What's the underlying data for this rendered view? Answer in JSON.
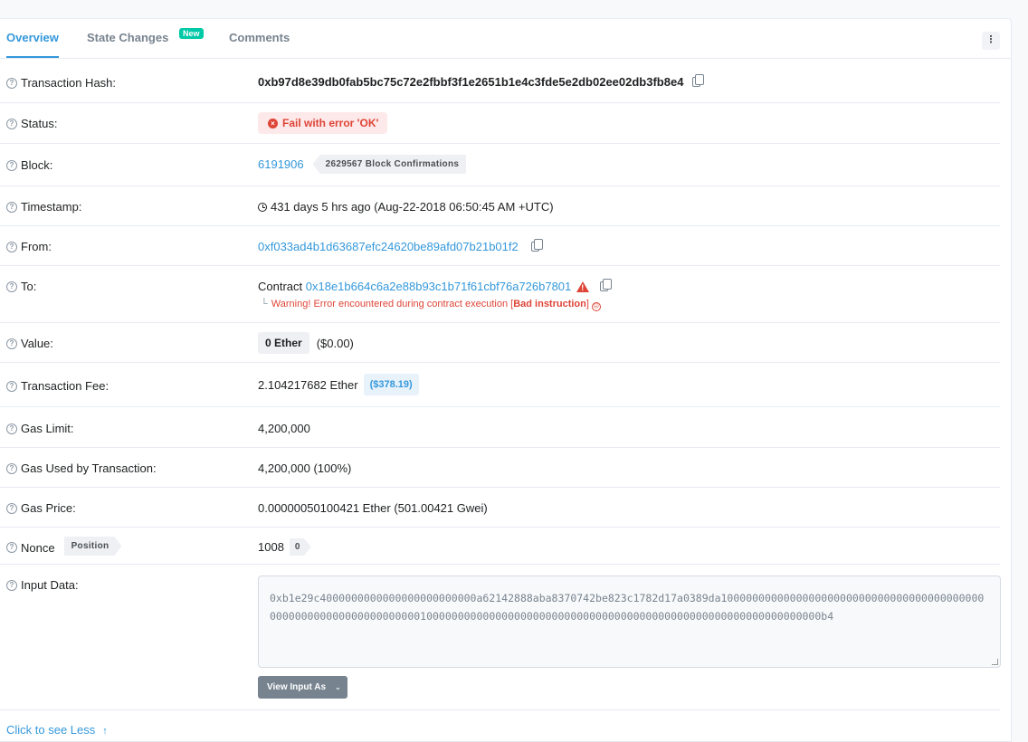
{
  "tabs": [
    {
      "label": "Overview",
      "active": true
    },
    {
      "label": "State Changes",
      "badge": "New"
    },
    {
      "label": "Comments"
    }
  ],
  "menu_icon": "more-vertical-icon",
  "rows": {
    "tx_hash": {
      "label": "Transaction Hash:",
      "value": "0xb97d8e39db0fab5bc75c72e2fbbf3f1e2651b1e4c3fde5e2db02ee02db3fb8e4"
    },
    "status": {
      "label": "Status:",
      "value": "Fail with error 'OK'"
    },
    "block": {
      "label": "Block:",
      "value": "6191906",
      "confirmations": "2629567 Block Confirmations"
    },
    "timestamp": {
      "label": "Timestamp:",
      "value": "431 days 5 hrs ago (Aug-22-2018 06:50:45 AM +UTC)"
    },
    "from": {
      "label": "From:",
      "value": "0xf033ad4b1d63687efc24620be89afd07b21b01f2"
    },
    "to": {
      "label": "To:",
      "prefix": "Contract",
      "value": "0x18e1b664c6a2e88b93c1b71f61cbf76a726b7801",
      "warning_pre": "Warning! Error encountered during contract execution [",
      "warning_bold": "Bad instruction",
      "warning_post": "]"
    },
    "value": {
      "label": "Value:",
      "amount": "0 Ether",
      "usd": "($0.00)"
    },
    "fee": {
      "label": "Transaction Fee:",
      "value": "2.104217682 Ether",
      "usd": "($378.19)"
    },
    "gas_limit": {
      "label": "Gas Limit:",
      "value": "4,200,000"
    },
    "gas_used": {
      "label": "Gas Used by Transaction:",
      "value": "4,200,000 (100%)"
    },
    "gas_price": {
      "label": "Gas Price:",
      "value": "0.00000050100421 Ether (501.00421 Gwei)"
    },
    "nonce": {
      "label": "Nonce",
      "position_label": "Position",
      "value": "1008",
      "position": "0"
    },
    "input": {
      "label": "Input Data:",
      "value": "0xb1e29c4000000000000000000000000a62142888aba8370742be823c1782d17a0389da1000000000000000000000000000000000000000000000000000000000000000001000000000000000000000000000000000000000000000000000000000000000b4",
      "button": "View Input As"
    }
  },
  "footer": {
    "see_less": "Click to see Less"
  },
  "colors": {
    "link": "#3498db",
    "error": "#de4437",
    "badge_new": "#00c9a7"
  }
}
